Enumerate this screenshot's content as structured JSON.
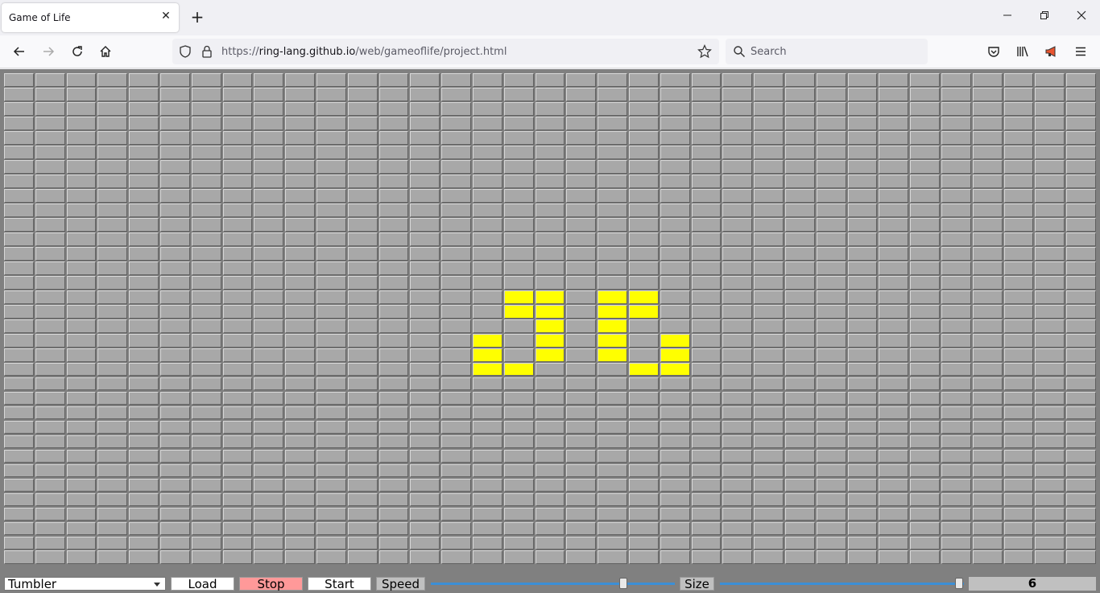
{
  "browser": {
    "tab_title": "Game of Life",
    "url_prefix": "https://",
    "url_host": "ring-lang.github.io",
    "url_path": "/web/gameoflife/project.html",
    "search_placeholder": "Search"
  },
  "game": {
    "columns": 35,
    "rows": 34,
    "alive_color": "#ffff00",
    "dead_color": "#a8a8a8",
    "alive_cells": [
      [
        15,
        16
      ],
      [
        15,
        17
      ],
      [
        15,
        19
      ],
      [
        15,
        20
      ],
      [
        16,
        16
      ],
      [
        16,
        17
      ],
      [
        16,
        19
      ],
      [
        16,
        20
      ],
      [
        17,
        17
      ],
      [
        17,
        19
      ],
      [
        18,
        15
      ],
      [
        18,
        17
      ],
      [
        18,
        19
      ],
      [
        18,
        21
      ],
      [
        19,
        15
      ],
      [
        19,
        17
      ],
      [
        19,
        19
      ],
      [
        19,
        21
      ],
      [
        20,
        15
      ],
      [
        20,
        16
      ],
      [
        20,
        20
      ],
      [
        20,
        21
      ]
    ]
  },
  "controls": {
    "pattern_selected": "Tumbler",
    "load_label": "Load",
    "stop_label": "Stop",
    "start_label": "Start",
    "speed_label": "Speed",
    "size_label": "Size",
    "speed_level": 0.79,
    "size_level": 0.98,
    "size_value": "6",
    "stop_color": "#ff9999"
  }
}
